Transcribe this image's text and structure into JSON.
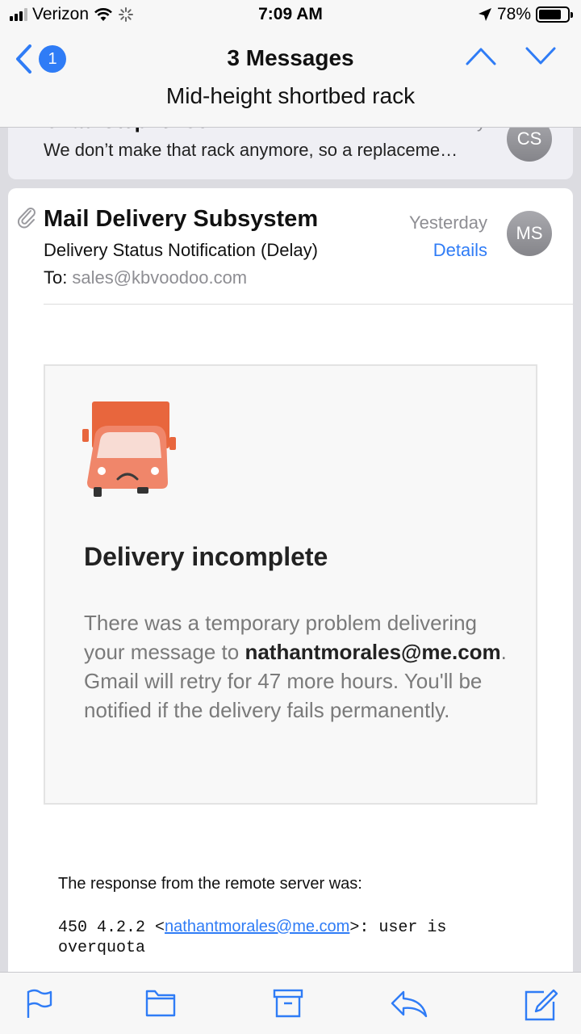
{
  "status_bar": {
    "carrier": "Verizon",
    "time": "7:09 AM",
    "battery": "78%",
    "battery_level": 0.78
  },
  "nav": {
    "back_count": "1",
    "title": "3 Messages",
    "subtitle": "Mid-height shortbed rack"
  },
  "previous_message": {
    "sender": "Chad Stephenson",
    "date": "Saturday",
    "snippet": "We don’t make that rack anymore, so a replaceme…",
    "avatar": "CS"
  },
  "message": {
    "sender": "Mail Delivery Subsystem",
    "date": "Yesterday",
    "details_label": "Details",
    "avatar": "MS",
    "subject": "Delivery Status Notification (Delay)",
    "to_label": "To:",
    "to_address": "sales@kbvoodoo.com",
    "notice": {
      "title": "Delivery incomplete",
      "body_1": "There was a temporary problem delivering your message to ",
      "email": "nathantmorales@me.com",
      "body_2": ". Gmail will retry for 47 more hours. You'll be notified if the delivery fails permanently."
    },
    "response_label": "The response from the remote server was:",
    "response_code_prefix": "450 4.2.2 <",
    "response_email": "nathantmorales@me.com",
    "response_code_suffix": ">: user is overquota"
  },
  "toolbar": {
    "icons": [
      "flag-icon",
      "folder-icon",
      "archive-icon",
      "reply-icon",
      "compose-icon"
    ]
  },
  "colors": {
    "accent": "#2f7cf6",
    "truck_orange": "#e8663d",
    "truck_body": "#f0866a"
  }
}
